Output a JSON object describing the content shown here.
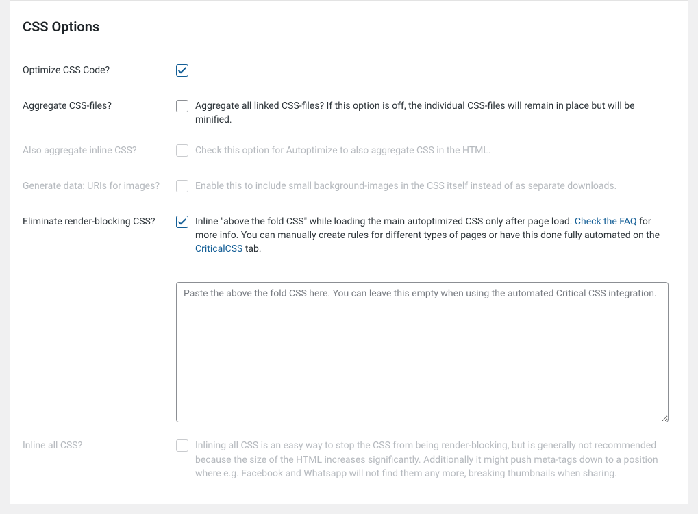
{
  "section_title": "CSS Options",
  "rows": {
    "optimize": {
      "label": "Optimize CSS Code?",
      "checked": true,
      "desc": ""
    },
    "aggregate": {
      "label": "Aggregate CSS-files?",
      "checked": false,
      "desc": "Aggregate all linked CSS-files? If this option is off, the individual CSS-files will remain in place but will be minified."
    },
    "inline_agg": {
      "label": "Also aggregate inline CSS?",
      "checked": false,
      "desc": "Check this option for Autoptimize to also aggregate CSS in the HTML."
    },
    "data_uris": {
      "label": "Generate data: URIs for images?",
      "checked": false,
      "desc": "Enable this to include small background-images in the CSS itself instead of as separate downloads."
    },
    "eliminate": {
      "label": "Eliminate render-blocking CSS?",
      "checked": true,
      "desc_pre": "Inline \"above the fold CSS\" while loading the main autoptimized CSS only after page load. ",
      "faq_link": "Check the FAQ",
      "desc_mid": " for more info. You can manually create rules for different types of pages or have this done fully automated on the ",
      "ccss_link": "CriticalCSS",
      "desc_post": " tab.",
      "textarea_placeholder": "Paste the above the fold CSS here. You can leave this empty when using the automated Critical CSS integration.",
      "textarea_value": ""
    },
    "inline_all": {
      "label": "Inline all CSS?",
      "checked": false,
      "desc": "Inlining all CSS is an easy way to stop the CSS from being render-blocking, but is generally not recommended because the size of the HTML increases significantly. Additionally it might push meta-tags down to a position where e.g. Facebook and Whatsapp will not find them any more, breaking thumbnails when sharing."
    }
  }
}
